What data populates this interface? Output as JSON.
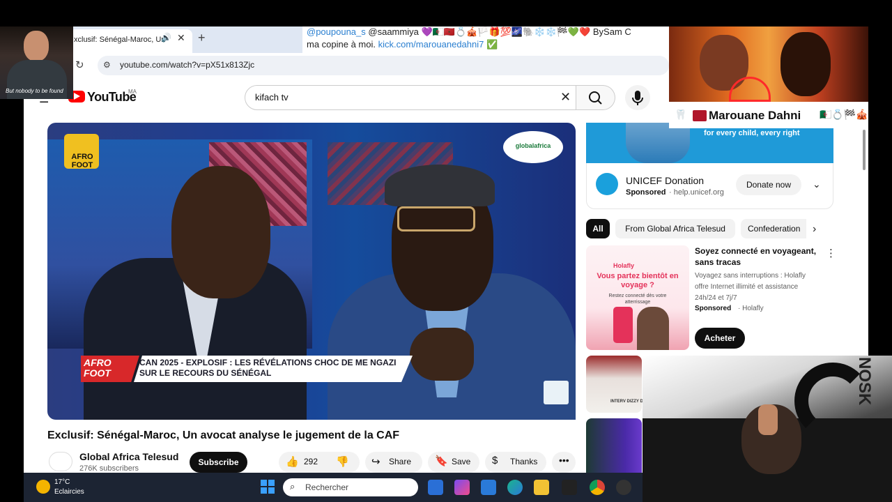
{
  "browser": {
    "tab_title": "xclusif: Sénégal-Maroc, Un",
    "url": "youtube.com/watch?v=pX51x813Zjc",
    "new_tab_icon": "+",
    "close_icon": "✕",
    "audio_icon": "🔊",
    "reload_icon": "↻",
    "site_info_icon": "⚙"
  },
  "youtube": {
    "logo": "YouTube",
    "region": "MA",
    "search_value": "kifach tv",
    "video": {
      "channel_logo": "AFRO FOOT",
      "network_logo": "globalafrica",
      "lower_third_tag": "AFRO FOOT",
      "lower_third_text": "CAN 2025 - EXPLOSIF : LES RÉVÉLATIONS CHOC DE ME NGAZI SUR LE RECOURS DU SÉNÉGAL"
    },
    "title": "Exclusif: Sénégal-Maroc, Un avocat analyse le jugement de la CAF",
    "channel_name": "Global Africa Telesud",
    "subscribers": "276K subscribers",
    "subscribe_label": "Subscribe",
    "likes": "292",
    "share_label": "Share",
    "save_label": "Save",
    "thanks_label": "Thanks",
    "ad": {
      "banner_text": "for every child, every right",
      "title": "UNICEF Donation",
      "sponsored": "Sponsored",
      "domain": "· help.unicef.org",
      "cta": "Donate now"
    },
    "chips": [
      "All",
      "From Global Africa Telesud",
      "Confederation"
    ],
    "holafly": {
      "brand": "Holafly",
      "headline": "Vous partez bientôt en voyage ?",
      "sub": "Restez connecté dès votre atterrissage",
      "title": "Soyez connecté en voyageant, sans tracas",
      "desc": "Voyagez sans interruptions : Holafly offre Internet illimité et assistance 24h/24 et 7j/7",
      "sponsored": "Sponsored",
      "source": "· Holafly",
      "cta": "Acheter"
    },
    "suggestion_label": "INTERV DIZZY D"
  },
  "overlays": {
    "cam_caption": "But nobody to be found",
    "chat_user1": "@poupouna_s",
    "chat_line1_rest": " @saammiya 💜🇩🇿🇲🇦💍🎪🏳️🎁💯🌌🐘❄️❄️🏁💚❤️ BySam C",
    "chat_line2_text": "ma copine à moi. ",
    "chat_link": "kick.com/marouanedahni7",
    "chat_verified": "✅",
    "name_emoji_left": "🦷",
    "streamer_name": "Marouane Dahni",
    "name_emoji_right": "🇩🇿💍🏁🎪",
    "webcam_sign": "NOSK"
  },
  "taskbar": {
    "temperature": "17°C",
    "weather": "Eclaircies",
    "search_placeholder": "Rechercher",
    "search_icon": "⌕"
  },
  "icons": {
    "search": "⌕",
    "mic": "🎙",
    "menu": "☰",
    "like": "👍",
    "dislike": "👎",
    "share": "↪",
    "save": "🔖",
    "thanks": "$",
    "more": "•••",
    "chevron_down": "⌄",
    "chevron_right": "›",
    "kebab": "⋮"
  },
  "colors": {
    "youtube_red": "#ff0000",
    "subscribe_bg": "#0f0f0f",
    "chat_blue": "#2a7fd0",
    "holafly_pink": "#e4325a",
    "unicef_blue": "#1aa0dc"
  }
}
